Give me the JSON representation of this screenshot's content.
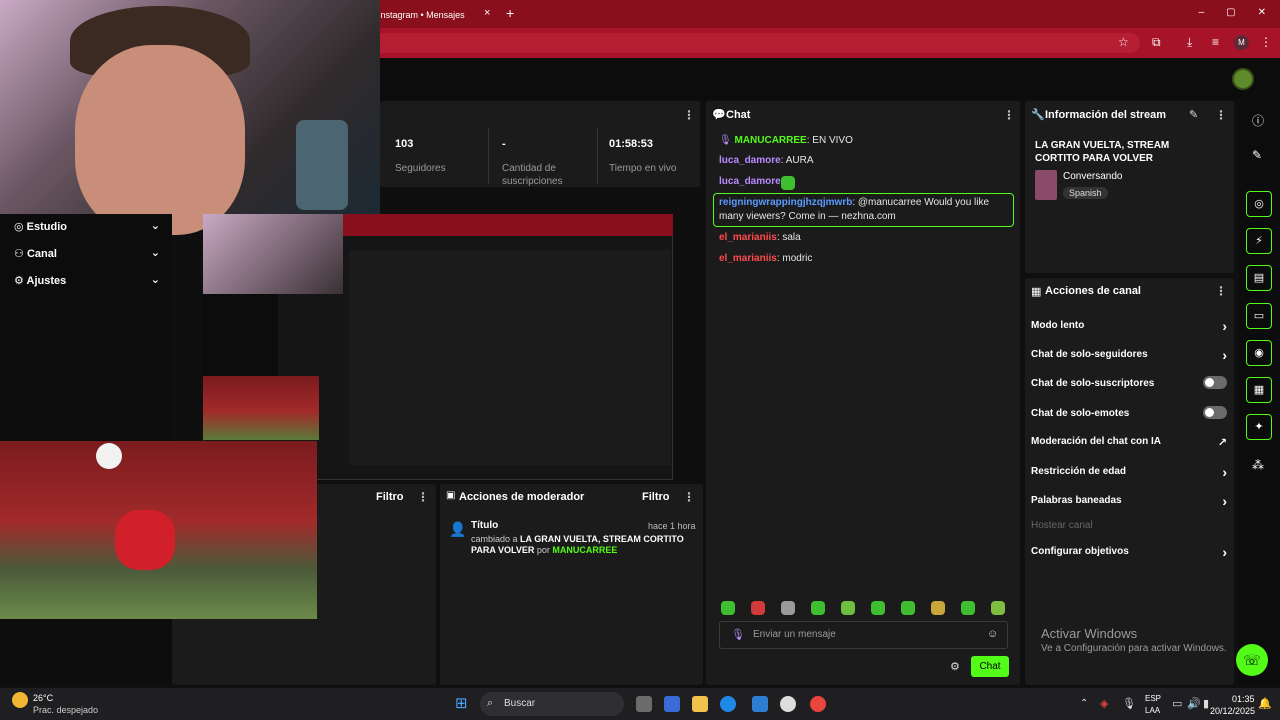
{
  "browser": {
    "tab_title": "Instagram • Mensajes",
    "tab_close": "×",
    "new_tab": "+",
    "window_controls": [
      "–",
      "▢",
      "✕"
    ],
    "profile_initial": "M"
  },
  "stats": {
    "items": [
      {
        "value": "103",
        "label": "Seguidores"
      },
      {
        "value": "-",
        "label": "Cantidad de suscripciones"
      },
      {
        "value": "01:58:53",
        "label": "Tiempo en vivo"
      }
    ]
  },
  "chat": {
    "title": "Chat",
    "messages": [
      {
        "user": "MANUCARREE",
        "text": ": EN VIVO",
        "color": "#53fc18"
      },
      {
        "user": "luca_damore",
        "text": ": AURA",
        "color": "#b98bff"
      },
      {
        "user": "luca_damore",
        "text": ":",
        "color": "#b98bff"
      },
      {
        "user": "reigningwrappingjhzqjmwrb",
        "text": ": @manucarree Would you like many viewers? Come in — nezhna.com",
        "color": "#5b9bff"
      },
      {
        "user": "el_marianiis",
        "text": ": sala",
        "color": "#ff4b4b"
      },
      {
        "user": "el_marianiis",
        "text": ": modric",
        "color": "#ff4b4b"
      }
    ],
    "input_placeholder": "Enviar un mensaje",
    "send_label": "Chat"
  },
  "stream_info": {
    "title": "Información del stream",
    "stream_title": "LA GRAN VUELTA, STREAM CORTITO PARA VOLVER",
    "category": "Conversando",
    "language": "Spanish"
  },
  "channel_actions": {
    "title": "Acciones de canal",
    "items": [
      {
        "label": "Modo lento",
        "control": "chevron"
      },
      {
        "label": "Chat de solo-seguidores",
        "control": "chevron"
      },
      {
        "label": "Chat de solo-suscriptores",
        "control": "toggle",
        "on": false
      },
      {
        "label": "Chat de solo-emotes",
        "control": "toggle",
        "on": false
      },
      {
        "label": "Moderación del chat con IA",
        "control": "external"
      },
      {
        "label": "Restricción de edad",
        "control": "chevron"
      },
      {
        "label": "Palabras baneadas",
        "control": "chevron"
      },
      {
        "label": "Hostear canal",
        "control": "disabled"
      },
      {
        "label": "Configurar objetivos",
        "control": "chevron"
      }
    ]
  },
  "mod_actions": {
    "title": "Acciones de moderador",
    "filter": "Filtro",
    "entry_title": "Título",
    "entry_time": "hace 1 hora",
    "entry_prefix": "cambiado a",
    "entry_value": "LA GRAN VUELTA, STREAM CORTITO PARA VOLVER",
    "entry_by": "por",
    "entry_user": "MANUCARREE"
  },
  "left_panel": {
    "filter": "Filtro"
  },
  "side_menu": {
    "items": [
      {
        "label": "Estudio"
      },
      {
        "label": "Canal"
      },
      {
        "label": "Ajustes"
      }
    ]
  },
  "windows": {
    "activate_title": "Activar Windows",
    "activate_sub": "Ve a Configuración para activar Windows."
  },
  "taskbar": {
    "weather_temp": "26°C",
    "weather_desc": "Prac. despejado",
    "search": "Buscar",
    "lang": "ESP",
    "lang2": "LAA",
    "time": "01:35",
    "date": "20/12/2025"
  },
  "colors": {
    "accent": "#53fc18",
    "chrome": "#a7142a"
  }
}
